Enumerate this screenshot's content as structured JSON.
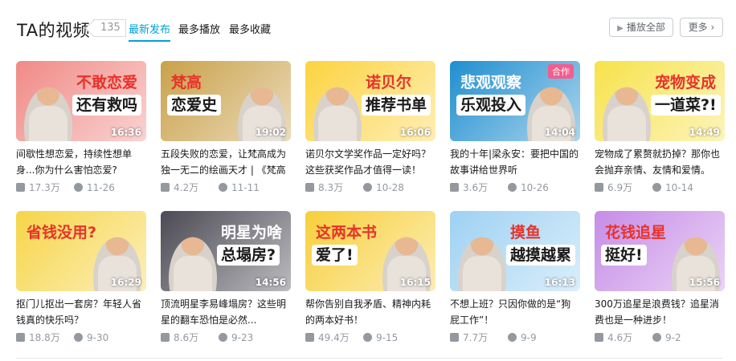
{
  "header": {
    "title": "TA的视频",
    "count": "135",
    "tabs": [
      "最新发布",
      "最多播放",
      "最多收藏"
    ],
    "play_all": "播放全部",
    "more": "更多"
  },
  "videos": [
    {
      "title": "间歇性想恋爱，持续性想单身...你为什么害怕恋爱?",
      "views": "17.3万",
      "date": "11-26",
      "duration": "16:36",
      "caption": [
        "不敢恋爱",
        "还有救吗"
      ]
    },
    {
      "title": "五段失败的恋爱，让梵高成为独一无二的绘画天才 | 《梵高",
      "views": "4.2万",
      "date": "11-11",
      "duration": "19:02",
      "caption": [
        "梵高",
        "恋爱史"
      ]
    },
    {
      "title": "诺贝尔文学奖作品一定好吗？这些获奖作品才值得一读！",
      "views": "8.3万",
      "date": "10-28",
      "duration": "16:06",
      "caption": [
        "诺贝尔",
        "推荐书单"
      ]
    },
    {
      "title": "我的十年|梁永安：要把中国的故事讲给世界听",
      "views": "3.6万",
      "date": "10-26",
      "duration": "14:04",
      "caption": [
        "悲观观察",
        "乐观投入"
      ],
      "badge": "合作"
    },
    {
      "title": "宠物成了累赘就扔掉？那你也会抛弃亲情、友情和爱情。",
      "views": "6.9万",
      "date": "10-14",
      "duration": "14:49",
      "caption": [
        "宠物变成",
        "一道菜?!"
      ]
    },
    {
      "title": "抠门儿抠出一套房？年轻人省钱真的快乐吗？",
      "views": "18.8万",
      "date": "9-30",
      "duration": "16:29",
      "caption": [
        "省钱没用?",
        ""
      ]
    },
    {
      "title": "顶流明星李易峰塌房？这些明星的翻车恐怕是必然...",
      "views": "8.6万",
      "date": "9-23",
      "duration": "14:56",
      "caption": [
        "明星为啥",
        "总塌房?"
      ]
    },
    {
      "title": "帮你告别自我矛盾、精神内耗的两本好书！",
      "views": "49.4万",
      "date": "9-15",
      "duration": "16:15",
      "caption": [
        "这两本书",
        "爱了!"
      ]
    },
    {
      "title": "不想上班？只因你做的是“狗屁工作”！",
      "views": "7.7万",
      "date": "9-9",
      "duration": "16:13",
      "caption": [
        "摸鱼",
        "越摸越累"
      ]
    },
    {
      "title": "300万追星是浪费钱？追星消费也是一种进步！",
      "views": "4.6万",
      "date": "9-2",
      "duration": "15:56",
      "caption": [
        "花钱追星",
        "挺好!"
      ]
    }
  ],
  "thumb_colors": [
    "#f08a86",
    "#c9a14a",
    "#fcd33f",
    "#1f8ecf",
    "#f7e24b",
    "#f6d548",
    "#4b4a54",
    "#f7cf3a",
    "#9ed1f2",
    "#c68ce6"
  ]
}
